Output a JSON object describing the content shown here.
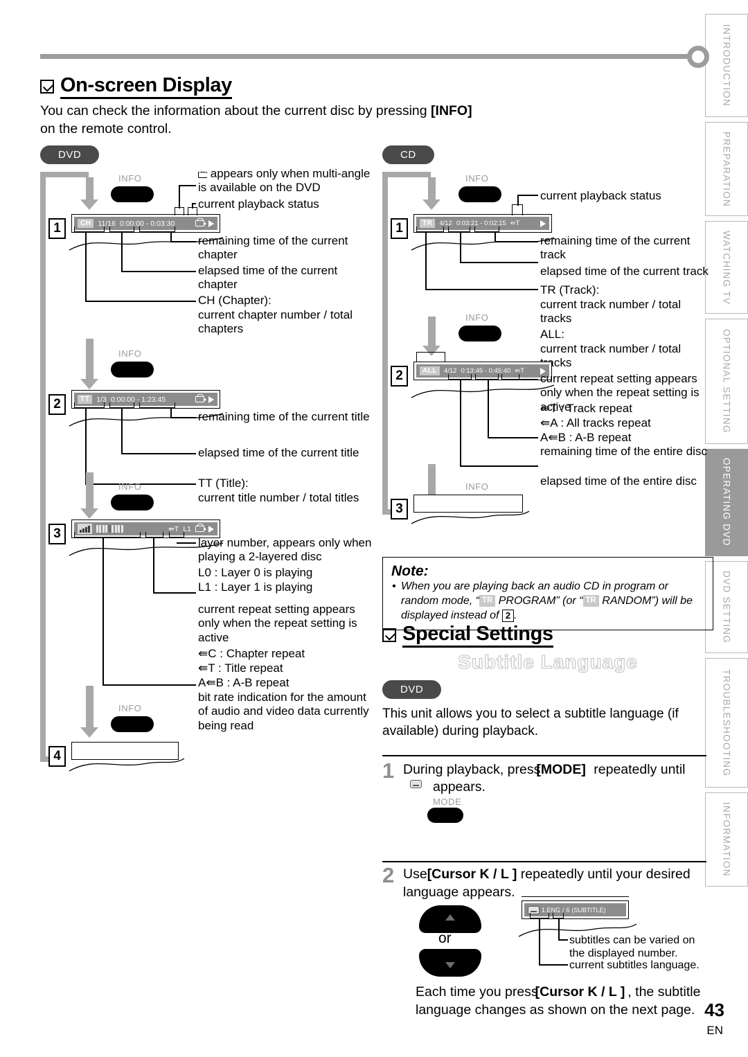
{
  "page": {
    "number": "43",
    "lang_code": "EN"
  },
  "sidebar": {
    "tabs": [
      {
        "label": "INTRODUCTION",
        "active": false
      },
      {
        "label": "PREPARATION",
        "active": false
      },
      {
        "label": "WATCHING TV",
        "active": false
      },
      {
        "label": "OPTIONAL SETTING",
        "active": false
      },
      {
        "label": "OPERATING DVD",
        "active": true
      },
      {
        "label": "DVD SETTING",
        "active": false
      },
      {
        "label": "TROUBLESHOOTING",
        "active": false
      },
      {
        "label": "INFORMATION",
        "active": false
      }
    ]
  },
  "onscreen": {
    "heading": "On-screen Display",
    "intro_a": "You can check the information about the current disc by pressing",
    "intro_overlay": "[INFO]",
    "intro_b": "on the remote control.",
    "dvd_pill": "DVD",
    "cd_pill": "CD",
    "info_label": "INFO",
    "dvd": {
      "step1_num": "1",
      "step2_num": "2",
      "step3_num": "3",
      "step4_num": "4",
      "bar1": {
        "tag": "CH",
        "numbers": "11/16",
        "times": "0:00:00 - 0:03:30"
      },
      "bar2": {
        "tag": "TT",
        "numbers": "1/3",
        "times": "0:00:00 - 1:23:45"
      },
      "bar3": {
        "repeat": "T",
        "layer": "L1"
      },
      "callouts": {
        "angle": "appears only when multi-angle is available on the DVD",
        "status": "current playback status",
        "remaining_chapter": "remaining time of the current chapter",
        "elapsed_chapter": "elapsed time of the current chapter",
        "ch_title": "CH (Chapter):",
        "ch_desc": "current chapter number / total chapters",
        "remaining_title": "remaining time of the current title",
        "elapsed_title": "elapsed time of the current title",
        "tt_title": "TT (Title):",
        "tt_desc": "current title number / total titles",
        "layer_desc": "layer number, appears only when playing a 2-layered disc",
        "layer_l0": "L0 :   Layer 0 is playing",
        "layer_l1": "L1 :   Layer 1 is playing",
        "repeat_desc": "current repeat setting appears only when the repeat setting is active",
        "repeat_c": "C :   Chapter repeat",
        "repeat_t": "T :   Title repeat",
        "repeat_ab": "B :  A-B repeat",
        "repeat_ab_pre": "A",
        "bitrate": "bit rate indication for the amount of audio and video data currently being read"
      }
    },
    "cd": {
      "step1_num": "1",
      "step2_num": "2",
      "step3_num": "3",
      "bar1": {
        "tag": "TR",
        "numbers": "4/12",
        "times": "0:03:21 - 0:02:15",
        "repeat": "T"
      },
      "bar2": {
        "tag": "ALL",
        "numbers": "4/12",
        "times": "0:13:45 - 0:45:40",
        "repeat": "T"
      },
      "callouts": {
        "status": "current playback status",
        "remaining_track": "remaining time of the current track",
        "elapsed_track": "elapsed time of the current track",
        "tr_title": "TR (Track):",
        "tr_desc": "current track number / total tracks",
        "all_title": "ALL:",
        "all_desc": "current track number / total tracks",
        "repeat_desc": "current repeat setting appears only when the repeat setting is active",
        "repeat_t": "T :    Track repeat",
        "repeat_a": "A :   All tracks repeat",
        "repeat_ab": "B :  A-B repeat",
        "repeat_ab_pre": "A",
        "remaining_disc": "remaining time of the entire disc",
        "elapsed_disc": "elapsed time of the entire disc"
      }
    },
    "note": {
      "title": "Note:",
      "text_a": "When you are playing back an audio CD in program or random mode, “",
      "tag1": "TR",
      "text_b": " PROGRAM” (or “",
      "tag2": "TR",
      "text_c": " RANDOM”) will be displayed instead of ",
      "num": "2",
      "text_d": "."
    }
  },
  "special": {
    "heading": "Special Settings",
    "subheading": "Subtitle Language",
    "pill": "DVD",
    "intro": "This unit allows you to select a subtitle language (if available) during playback.",
    "step1": {
      "num": "1",
      "text_a": "During playback, press",
      "text_key": "[MODE]",
      "text_b": " repeatedly until",
      "text_c": "appears.",
      "button_label": "MODE"
    },
    "step2": {
      "num": "2",
      "text_a": "Use",
      "text_key": "[Cursor K / L ]",
      "text_b": " repeatedly until your desired language appears.",
      "or_label": "or",
      "osd": {
        "lang": "1.ENG",
        "sep": "/",
        "count": "6",
        "mode": "(SUBTITLE)"
      },
      "callout_varied": "subtitles can be varied on the displayed number.",
      "callout_current": "current subtitles language."
    },
    "footer_a": "Each time you press",
    "footer_key": "[Cursor K / L ]",
    "footer_b": ", the subtitle language changes as shown on the next page."
  }
}
